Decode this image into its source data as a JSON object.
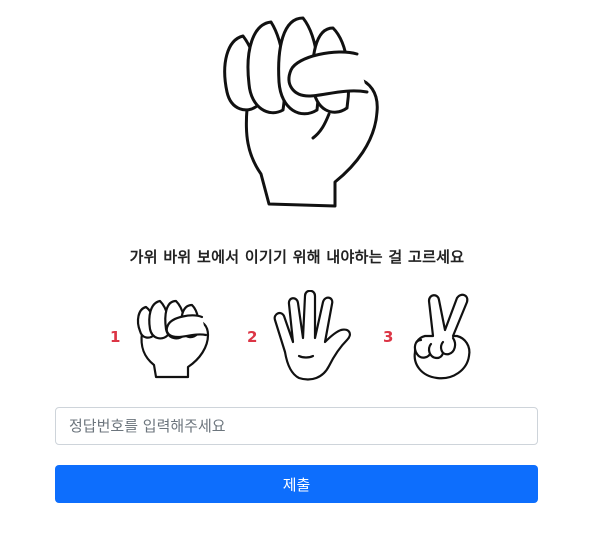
{
  "question": "가위 바위 보에서 이기기 위해 내야하는 걸 고르세요",
  "main_image": {
    "icon": "rock-fist-icon"
  },
  "options": [
    {
      "number": "1",
      "icon": "rock-fist-icon"
    },
    {
      "number": "2",
      "icon": "paper-open-hand-icon"
    },
    {
      "number": "3",
      "icon": "scissors-hand-icon"
    }
  ],
  "answer_input": {
    "placeholder": "정답번호를 입력해주세요",
    "value": ""
  },
  "submit_button": {
    "label": "제출"
  },
  "colors": {
    "primary": "#0d6efd",
    "number": "#dc3545",
    "border": "#ced4da"
  }
}
